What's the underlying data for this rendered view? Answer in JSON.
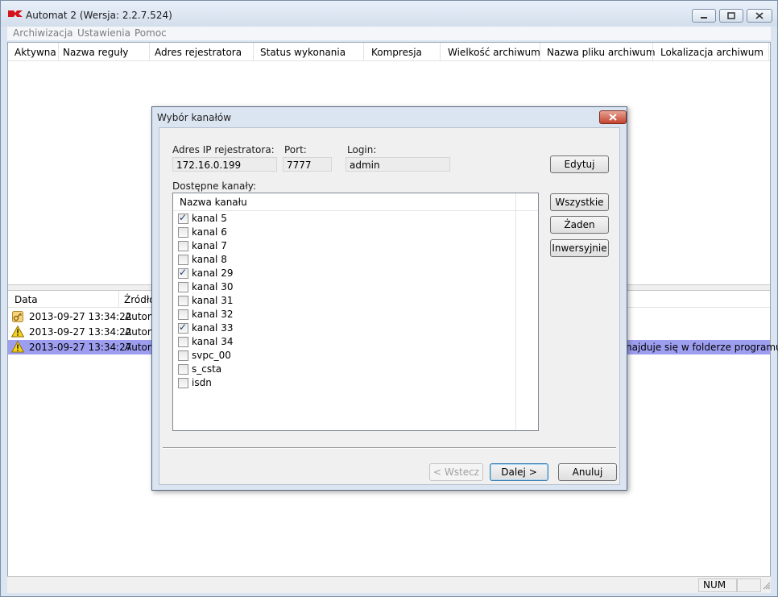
{
  "window": {
    "title": "Automat 2 (Wersja: 2.2.7.524)"
  },
  "menu": [
    "Archiwizacja",
    "Ustawienia",
    "Pomoc"
  ],
  "rules_table": {
    "columns": [
      "Aktywna",
      "Nazwa reguły",
      "Adres rejestratora",
      "Status wykonania",
      "Kompresja",
      "Wielkość archiwum",
      "Nazwa pliku archiwum",
      "Lokalizacja archiwum"
    ]
  },
  "log_table": {
    "columns": [
      "Data",
      "Źródło"
    ],
    "rows": [
      {
        "icon": "key-icon",
        "date": "2013-09-27 13:34:22",
        "source": "Autom",
        "message": ""
      },
      {
        "icon": "warning-icon",
        "date": "2013-09-27 13:34:22",
        "source": "Autom",
        "message": ""
      },
      {
        "icon": "warning-icon",
        "date": "2013-09-27 13:34:27",
        "source": "Autom",
        "message": "najduje się w folderze programu l",
        "selected": true
      }
    ]
  },
  "statusbar": {
    "num": "NUM"
  },
  "dialog": {
    "title": "Wybór kanałów",
    "ip_label": "Adres IP rejestratora:",
    "ip_value": "172.16.0.199",
    "port_label": "Port:",
    "port_value": "7777",
    "login_label": "Login:",
    "login_value": "admin",
    "edit_button": "Edytuj",
    "channels_label": "Dostępne kanały:",
    "channels_column": "Nazwa kanału",
    "channels": [
      {
        "name": "kanal 5",
        "checked": true
      },
      {
        "name": "kanal 6",
        "checked": false
      },
      {
        "name": "kanal 7",
        "checked": false
      },
      {
        "name": "kanal 8",
        "checked": false
      },
      {
        "name": "kanal 29",
        "checked": true
      },
      {
        "name": "kanal 30",
        "checked": false
      },
      {
        "name": "kanal 31",
        "checked": false
      },
      {
        "name": "kanal 32",
        "checked": false
      },
      {
        "name": "kanal 33",
        "checked": true
      },
      {
        "name": "kanal 34",
        "checked": false
      },
      {
        "name": "svpc_00",
        "checked": false
      },
      {
        "name": "s_csta",
        "checked": false
      },
      {
        "name": "isdn",
        "checked": false
      }
    ],
    "all_button": "Wszystkie",
    "none_button": "Żaden",
    "invert_button": "Inwersyjnie",
    "back_button": "< Wstecz",
    "next_button": "Dalej >",
    "cancel_button": "Anuluj"
  },
  "colors": {
    "selection": "#9e9ef0",
    "close_red": "#c4432e",
    "brand_red": "#d4141c"
  }
}
